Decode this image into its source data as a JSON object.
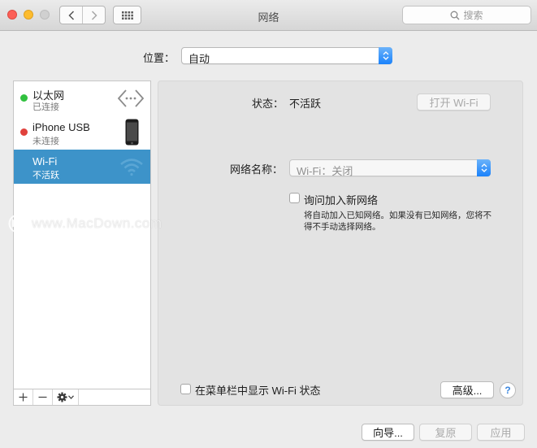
{
  "window": {
    "title": "网络"
  },
  "search": {
    "placeholder": "搜索"
  },
  "location": {
    "label": "位置：",
    "value": "自动"
  },
  "services": [
    {
      "name": "以太网",
      "status": "已连接",
      "status_color": "#31c13f",
      "icon": "ethernet-arrows-icon"
    },
    {
      "name": "iPhone USB",
      "status": "未连接",
      "status_color": "#e0413c",
      "icon": "iphone-icon"
    },
    {
      "name": "Wi-Fi",
      "status": "不活跃",
      "status_color": "#3d93c9",
      "icon": "wifi-icon",
      "selected": true
    }
  ],
  "sidebar_toolbar": {
    "add": "+",
    "remove": "—"
  },
  "panel": {
    "status_label": "状态：",
    "status_value": "不活跃",
    "turn_on_button": "打开 Wi-Fi",
    "network_name_label": "网络名称：",
    "network_name_value": "Wi-Fi：关闭",
    "ask_join_label": "询问加入新网络",
    "ask_join_hint": "将自动加入已知网络。如果没有已知网络，您将不得不手动选择网络。",
    "show_menubar_label": "在菜单栏中显示 Wi-Fi 状态",
    "advanced_button": "高级...",
    "help": "?"
  },
  "footer": {
    "assist": "向导...",
    "revert": "复原",
    "apply": "应用"
  },
  "watermark": "www.MacDown.com",
  "colors": {
    "accent": "#1a82fb",
    "selection": "#3d93c9"
  }
}
